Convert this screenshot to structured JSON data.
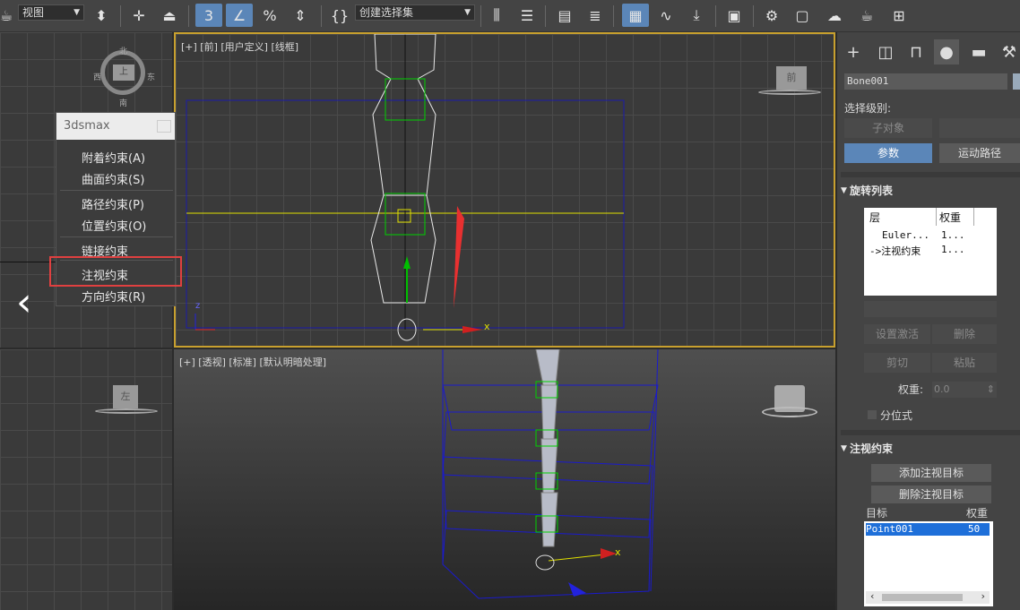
{
  "toolbar": {
    "view_select": "视图",
    "selection_set": "创建选择集",
    "items": [
      "teapot-icon",
      "select-filter-icon",
      "move-icon",
      "select-icon",
      "snap-3-icon",
      "angle-snap-icon",
      "percent-snap-icon",
      "spinner-snap-icon",
      "named-sel-icon",
      "mirror-icon",
      "align-icon",
      "layer-icon",
      "layers-icon",
      "toolbar-icon",
      "curve-editor-icon",
      "dope-sheet-icon",
      "material-editor-icon",
      "render-setup-icon",
      "render-frame-icon",
      "render-icon",
      "render-cloud-icon",
      "viewport-layout-icon"
    ]
  },
  "viewports": {
    "front_label": "[+] [前] [用户定义] [线框]",
    "persp_label": "[+] [透视] [标准] [默认明暗处理]",
    "viewcube_top": "上",
    "viewcube_front": "前",
    "viewcube_left": "左",
    "compass_n": "北",
    "compass_s": "南",
    "compass_w": "西",
    "compass_e": "东",
    "axis_x": "x",
    "axis_z": "z"
  },
  "context_menu": {
    "title": "3dsmax",
    "items": [
      {
        "label": "附着约束(A)"
      },
      {
        "label": "曲面约束(S)"
      },
      {
        "label": "路径约束(P)"
      },
      {
        "label": "位置约束(O)"
      },
      {
        "label": "链接约束"
      },
      {
        "label": "注视约束"
      },
      {
        "label": "方向约束(R)"
      }
    ]
  },
  "panel": {
    "object_name": "Bone001",
    "selection_level_label": "选择级别:",
    "sub_object_btn": "子对象",
    "params_btn": "参数",
    "motion_path_btn": "运动路径",
    "rotation_list": {
      "title": "旋转列表",
      "col_layer": "层",
      "col_weight": "权重",
      "rows": [
        {
          "layer": "Euler...",
          "weight": "1..."
        },
        {
          "layer": "->注视约束",
          "weight": "1..."
        }
      ],
      "set_active_btn": "设置激活",
      "delete_btn": "删除",
      "cut_btn": "剪切",
      "paste_btn": "粘贴",
      "weight_label": "权重:",
      "weight_value": "0.0",
      "axis_label": "分位式"
    },
    "lookat": {
      "title": "注视约束",
      "add_btn": "添加注视目标",
      "remove_btn": "删除注视目标",
      "col_target": "目标",
      "col_weight": "权重",
      "rows": [
        {
          "target": "Point001",
          "weight": "50"
        }
      ]
    }
  },
  "colors": {
    "accent": "#5b86b8",
    "highlight_red": "#e04040",
    "bone_green": "#00ff00",
    "wire_blue": "#1a1acc"
  }
}
